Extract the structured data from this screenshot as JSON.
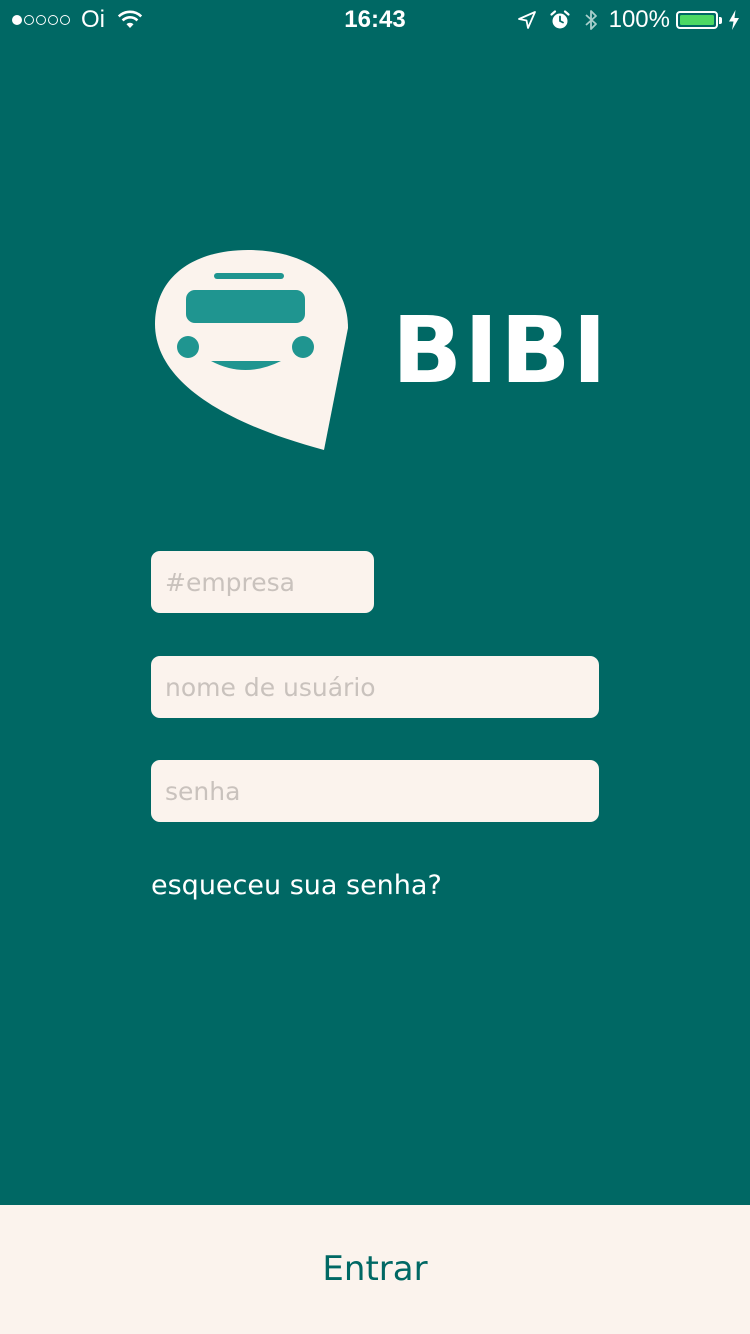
{
  "status_bar": {
    "carrier": "Oi",
    "time": "16:43",
    "battery_percent": "100%",
    "signal_strength_dots_filled": 1,
    "signal_strength_dots_total": 5,
    "battery_level": 1.0,
    "icons": [
      "signal-dots-icon",
      "wifi-icon",
      "location-arrow-icon",
      "alarm-clock-icon",
      "bluetooth-icon",
      "battery-icon",
      "charging-bolt-icon"
    ]
  },
  "brand": {
    "name": "BIBI",
    "logo_icon": "bus-speech-bubble-icon"
  },
  "form": {
    "company_placeholder": "#empresa",
    "company_value": "",
    "username_placeholder": "nome de usuário",
    "username_value": "",
    "password_placeholder": "senha",
    "password_value": "",
    "forgot_password": "esqueceu sua senha?"
  },
  "actions": {
    "login_label": "Entrar"
  },
  "colors": {
    "background": "#006864",
    "light": "#fbf3ed",
    "accent": "#1f9590",
    "battery": "#4cd964"
  }
}
